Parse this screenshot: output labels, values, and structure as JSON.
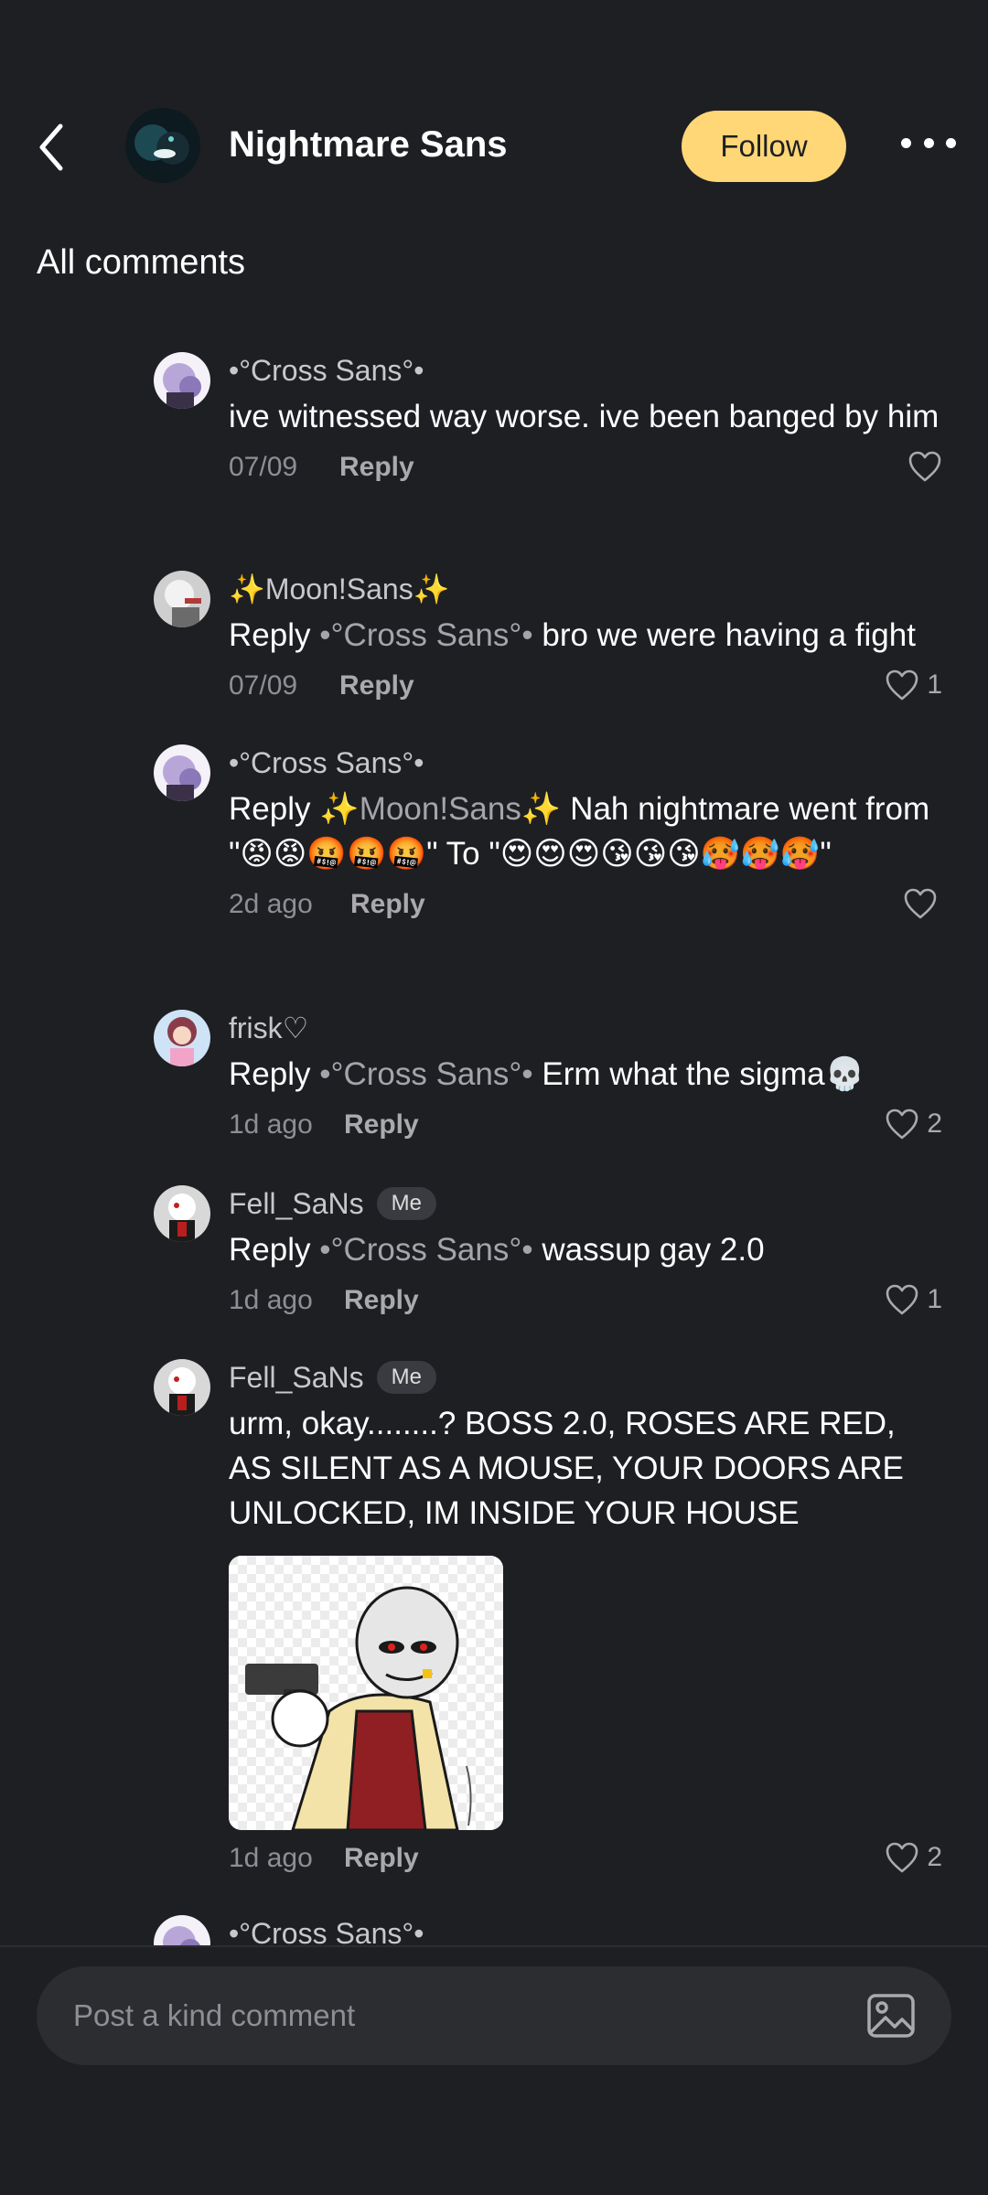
{
  "header": {
    "channel_name": "Nightmare Sans",
    "follow_label": "Follow"
  },
  "section_title": "All comments",
  "comments": [
    {
      "author": "•°Cross Sans°•",
      "badge": "",
      "reply_word": "",
      "mention": "",
      "text": "ive witnessed way worse. ive been banged by him",
      "date": "07/09",
      "reply_label": "Reply",
      "likes": ""
    },
    {
      "author": "✨Moon!Sans✨",
      "badge": "",
      "reply_word": "Reply",
      "mention": "•°Cross Sans°•",
      "text": "bro we were having a fight",
      "date": "07/09",
      "reply_label": "Reply",
      "likes": "1"
    },
    {
      "author": "•°Cross Sans°•",
      "badge": "",
      "reply_word": "Reply",
      "mention": "✨Moon!Sans✨",
      "text": "Nah nightmare went from \"😡😡🤬🤬🤬\" To \"😍😍😍😘😘😘🥵🥵🥵\"",
      "date": "2d ago",
      "reply_label": "Reply",
      "likes": ""
    },
    {
      "author": "frisk♡",
      "badge": "",
      "reply_word": "Reply",
      "mention": "•°Cross Sans°•",
      "text": "Erm what the sigma💀",
      "date": "1d ago",
      "reply_label": "Reply",
      "likes": "2"
    },
    {
      "author": "Fell_SaNs",
      "badge": "Me",
      "reply_word": "Reply",
      "mention": "•°Cross Sans°•",
      "text": "wassup gay 2.0",
      "date": "1d ago",
      "reply_label": "Reply",
      "likes": "1"
    },
    {
      "author": "Fell_SaNs",
      "badge": "Me",
      "reply_word": "",
      "mention": "",
      "text": "urm, okay........? BOSS 2.0, ROSES ARE RED, AS SILENT AS A MOUSE, YOUR DOORS ARE UNLOCKED, IM INSIDE YOUR HOUSE",
      "date": "1d ago",
      "reply_label": "Reply",
      "likes": "2"
    },
    {
      "author": "•°Cross Sans°•"
    }
  ],
  "composer": {
    "placeholder": "Post a kind comment"
  },
  "colors": {
    "background": "#1e1f23",
    "follow_button": "#ffd776",
    "muted_text": "#8e8e94",
    "input_background": "#2c2d31"
  },
  "icons": [
    "back-chevron-icon",
    "more-dots-icon",
    "heart-icon",
    "image-icon"
  ]
}
